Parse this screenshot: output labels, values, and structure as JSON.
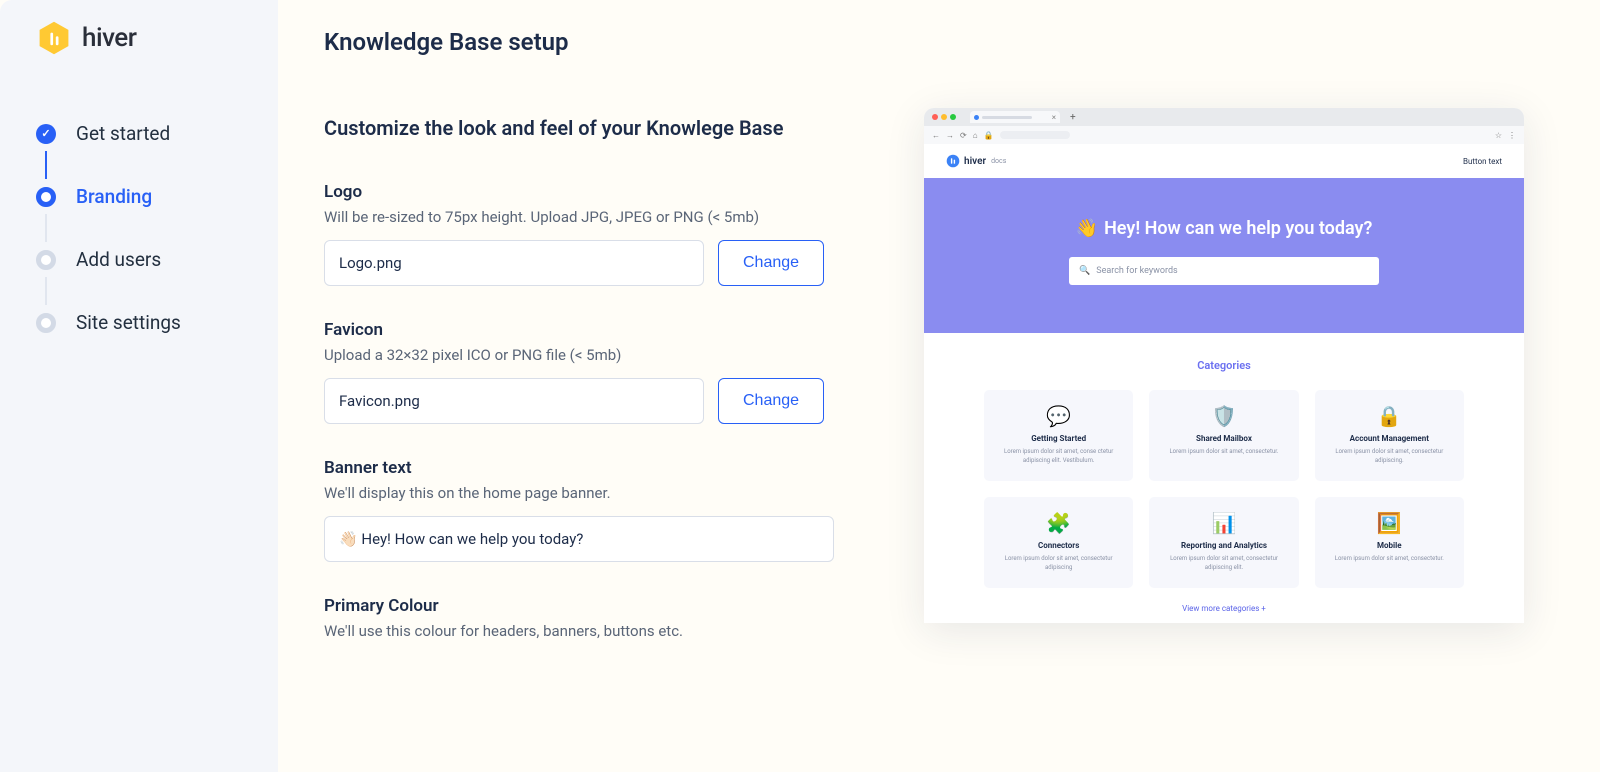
{
  "brand": {
    "name": "hiver"
  },
  "sidebar": {
    "steps": [
      {
        "label": "Get started",
        "state": "done"
      },
      {
        "label": "Branding",
        "state": "active"
      },
      {
        "label": "Add users",
        "state": "pending"
      },
      {
        "label": "Site settings",
        "state": "pending"
      }
    ]
  },
  "page": {
    "title": "Knowledge Base setup",
    "section_title": "Customize the look and feel of your Knowlege Base"
  },
  "fields": {
    "logo": {
      "label": "Logo",
      "desc": "Will be re-sized to 75px height. Upload JPG, JPEG or PNG (< 5mb)",
      "value": "Logo.png",
      "button": "Change"
    },
    "favicon": {
      "label": "Favicon",
      "desc": "Upload a 32×32 pixel ICO or PNG file (< 5mb)",
      "value": "Favicon.png",
      "button": "Change"
    },
    "banner": {
      "label": "Banner text",
      "desc": "We'll display this on the home page banner.",
      "value": "👋🏻 Hey! How can we help you today?"
    },
    "primary": {
      "label": "Primary Colour",
      "desc": "We'll use this colour for headers, banners, buttons etc."
    }
  },
  "preview": {
    "logo_text": "hiver",
    "logo_sub": "docs",
    "button_text": "Button text",
    "banner_title": "Hey! How can we help you today?",
    "banner_emoji": "👋",
    "search_placeholder": "Search for keywords",
    "categories_title": "Categories",
    "cards": [
      {
        "icon": "💬",
        "title": "Getting Started",
        "desc": "Lorem ipsum dolor sit amet, conse ctetur adipiscing elit. Vestibulum."
      },
      {
        "icon": "🛡️",
        "title": "Shared Mailbox",
        "desc": "Lorem ipsum dolor sit amet, consectetur."
      },
      {
        "icon": "🔒",
        "title": "Account Management",
        "desc": "Lorem ipsum dolor sit amet, consectetur adipiscing."
      },
      {
        "icon": "🧩",
        "title": "Connectors",
        "desc": "Lorem ipsum dolor sit amet, consectetur adipiscing"
      },
      {
        "icon": "📊",
        "title": "Reporting and Analytics",
        "desc": "Lorem ipsum dolor sit amet, consectetur adipiscing elit."
      },
      {
        "icon": "🖼️",
        "title": "Mobile",
        "desc": "Lorem ipsum dolor sit amet, consectetur."
      }
    ],
    "more": "View more categories +"
  }
}
